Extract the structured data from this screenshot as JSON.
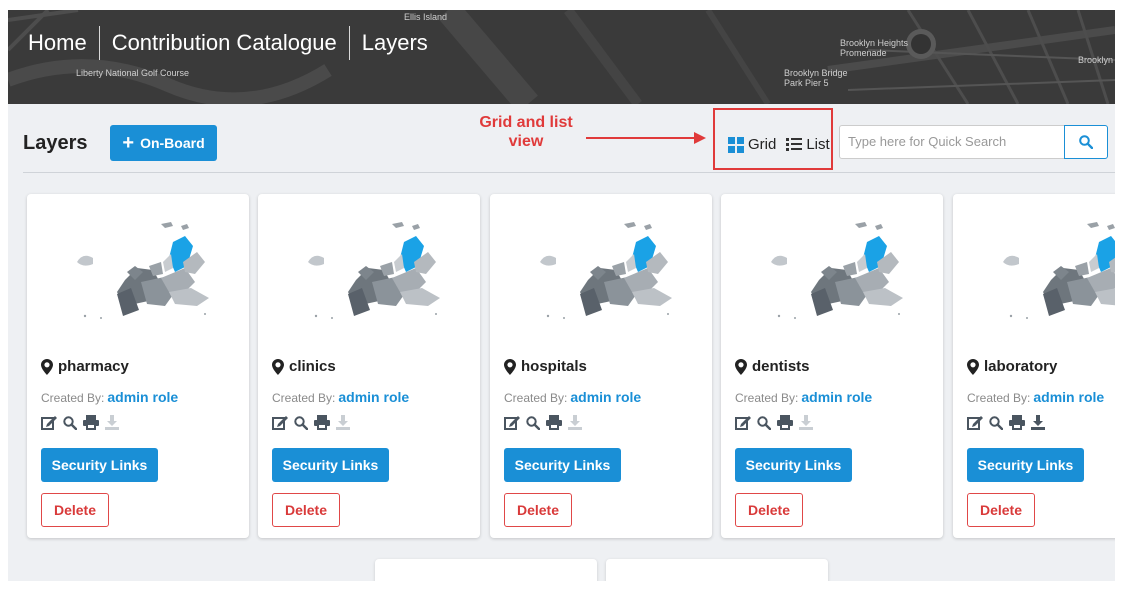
{
  "header": {
    "breadcrumbs": [
      "Home",
      "Contribution Catalogue",
      "Layers"
    ],
    "map_labels": [
      "Liberty National Golf Course",
      "Ellis Island",
      "Brooklyn Heights Promenade",
      "Brooklyn Bridge Park Pier 5",
      "Brooklyn"
    ]
  },
  "toolbar": {
    "title": "Layers",
    "onboard_label": "On-Board",
    "grid_label": "Grid",
    "list_label": "List",
    "search_placeholder": "Type here for Quick Search"
  },
  "annotation": {
    "text": "Grid and list view",
    "color": "#e03a3a"
  },
  "cards": [
    {
      "name": "pharmacy",
      "created_by_label": "Created By:",
      "created_by": "admin role",
      "security_label": "Security Links",
      "delete_label": "Delete",
      "download_enabled": false
    },
    {
      "name": "clinics",
      "created_by_label": "Created By:",
      "created_by": "admin role",
      "security_label": "Security Links",
      "delete_label": "Delete",
      "download_enabled": false
    },
    {
      "name": "hospitals",
      "created_by_label": "Created By:",
      "created_by": "admin role",
      "security_label": "Security Links",
      "delete_label": "Delete",
      "download_enabled": false
    },
    {
      "name": "dentists",
      "created_by_label": "Created By:",
      "created_by": "admin role",
      "security_label": "Security Links",
      "delete_label": "Delete",
      "download_enabled": false
    },
    {
      "name": "laboratory",
      "created_by_label": "Created By:",
      "created_by": "admin role",
      "security_label": "Security Links",
      "delete_label": "Delete",
      "download_enabled": true
    }
  ],
  "colors": {
    "accent": "#1a8fd6",
    "danger": "#d93a3a",
    "header_bg": "#3b3b3b",
    "page_bg": "#eef0f3"
  },
  "icons": [
    "map-marker-icon",
    "edit-icon",
    "search-icon",
    "print-icon",
    "download-icon",
    "grid-icon",
    "list-icon",
    "plus-icon"
  ]
}
